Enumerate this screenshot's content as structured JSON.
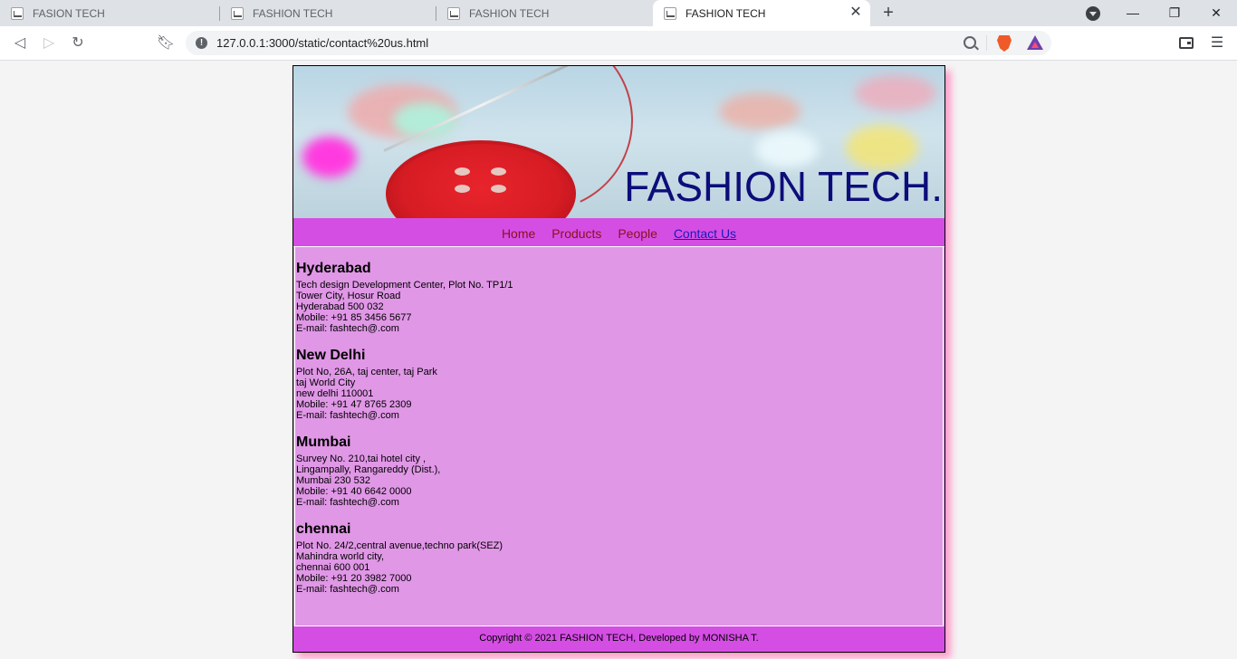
{
  "browser": {
    "tabs": [
      {
        "title": "FASION TECH"
      },
      {
        "title": "FASHION TECH"
      },
      {
        "title": "FASHION TECH"
      },
      {
        "title": "FASHION TECH"
      }
    ],
    "url": "127.0.0.1:3000/static/contact%20us.html"
  },
  "site": {
    "brand": "FASHION TECH.",
    "nav": [
      "Home",
      "Products",
      "People",
      "Contact Us"
    ],
    "offices": [
      {
        "city": "Hyderabad",
        "lines": [
          "Tech design Development Center, Plot No. TP1/1",
          "Tower City, Hosur Road",
          "Hyderabad 500 032",
          "Mobile: +91 85 3456 5677",
          "E-mail: fashtech@.com"
        ]
      },
      {
        "city": "New Delhi",
        "lines": [
          "Plot No, 26A, taj center, taj Park",
          "taj World City",
          "new delhi 110001",
          "Mobile: +91 47 8765 2309",
          "E-mail: fashtech@.com"
        ]
      },
      {
        "city": "Mumbai",
        "lines": [
          "Survey No. 210,tai hotel city ,",
          "Lingampally, Rangareddy (Dist.),",
          "Mumbai 230 532",
          "Mobile: +91 40 6642 0000",
          "E-mail: fashtech@.com"
        ]
      },
      {
        "city": "chennai",
        "lines": [
          "Plot No. 24/2,central avenue,techno park(SEZ)",
          "Mahindra world city,",
          "chennai 600 001",
          "Mobile: +91 20 3982 7000",
          "E-mail: fashtech@.com"
        ]
      }
    ],
    "footer": "Copyright © 2021 FASHION TECH, Developed by MONISHA T."
  },
  "colors": {
    "nav_bg": "#d54ee4",
    "content_bg": "#e097e6",
    "brand_text": "#0d0d7a",
    "nav_link": "#8b1020",
    "nav_link_active": "#1a1ab8"
  },
  "icons": {
    "back": "back-icon",
    "forward": "forward-icon",
    "reload": "reload-icon",
    "bookmark": "bookmark-icon",
    "info": "info-icon",
    "zoom": "zoom-icon",
    "brave": "brave-shield-icon",
    "rewards": "brave-rewards-icon",
    "wallet": "wallet-icon",
    "menu": "menu-icon"
  }
}
